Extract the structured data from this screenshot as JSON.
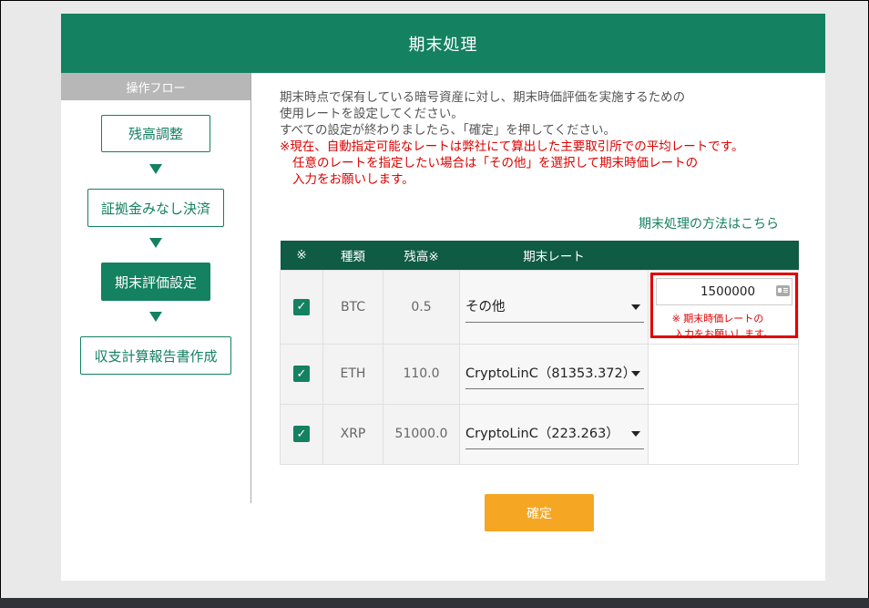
{
  "header": {
    "title": "期末処理"
  },
  "sidebar": {
    "flow_title": "操作フロー",
    "steps": [
      {
        "label": "残高調整",
        "active": false
      },
      {
        "label": "証拠金みなし決済",
        "active": false
      },
      {
        "label": "期末評価設定",
        "active": true
      },
      {
        "label": "収支計算報告書作成",
        "active": false
      }
    ]
  },
  "description": {
    "line1": "期末時点で保有している暗号資産に対し、期末時価評価を実施するための",
    "line2": "使用レートを設定してください。",
    "line3": "すべての設定が終わりましたら、「確定」を押してください。",
    "notice1": "※現在、自動指定可能なレートは弊社にて算出した主要取引所での平均レートです。",
    "notice2": "任意のレートを指定したい場合は「その他」を選択して期末時価レートの",
    "notice3": "入力をお願いします。"
  },
  "howto_link": "期末処理の方法はこちら",
  "table": {
    "headers": {
      "check": "※",
      "type": "種類",
      "balance": "残高※",
      "rate": "期末レート",
      "extra": ""
    },
    "rows": [
      {
        "checked": true,
        "check_mark": "✓",
        "type": "BTC",
        "balance": "0.5",
        "rate": "その他"
      },
      {
        "checked": true,
        "check_mark": "✓",
        "type": "ETH",
        "balance": "110.0",
        "rate": "CryptoLinC（81353.372）"
      },
      {
        "checked": true,
        "check_mark": "✓",
        "type": "XRP",
        "balance": "51000.0",
        "rate": "CryptoLinC（223.263）"
      }
    ],
    "custom_rate": {
      "value": "1500000",
      "note_line1": "※ 期末時価レートの",
      "note_line2": "入力をお願いします。"
    }
  },
  "confirm_label": "確定",
  "colors": {
    "brand": "#148160",
    "header_dark": "#0f5b43",
    "confirm": "#f5a623",
    "alert": "#e00000"
  }
}
